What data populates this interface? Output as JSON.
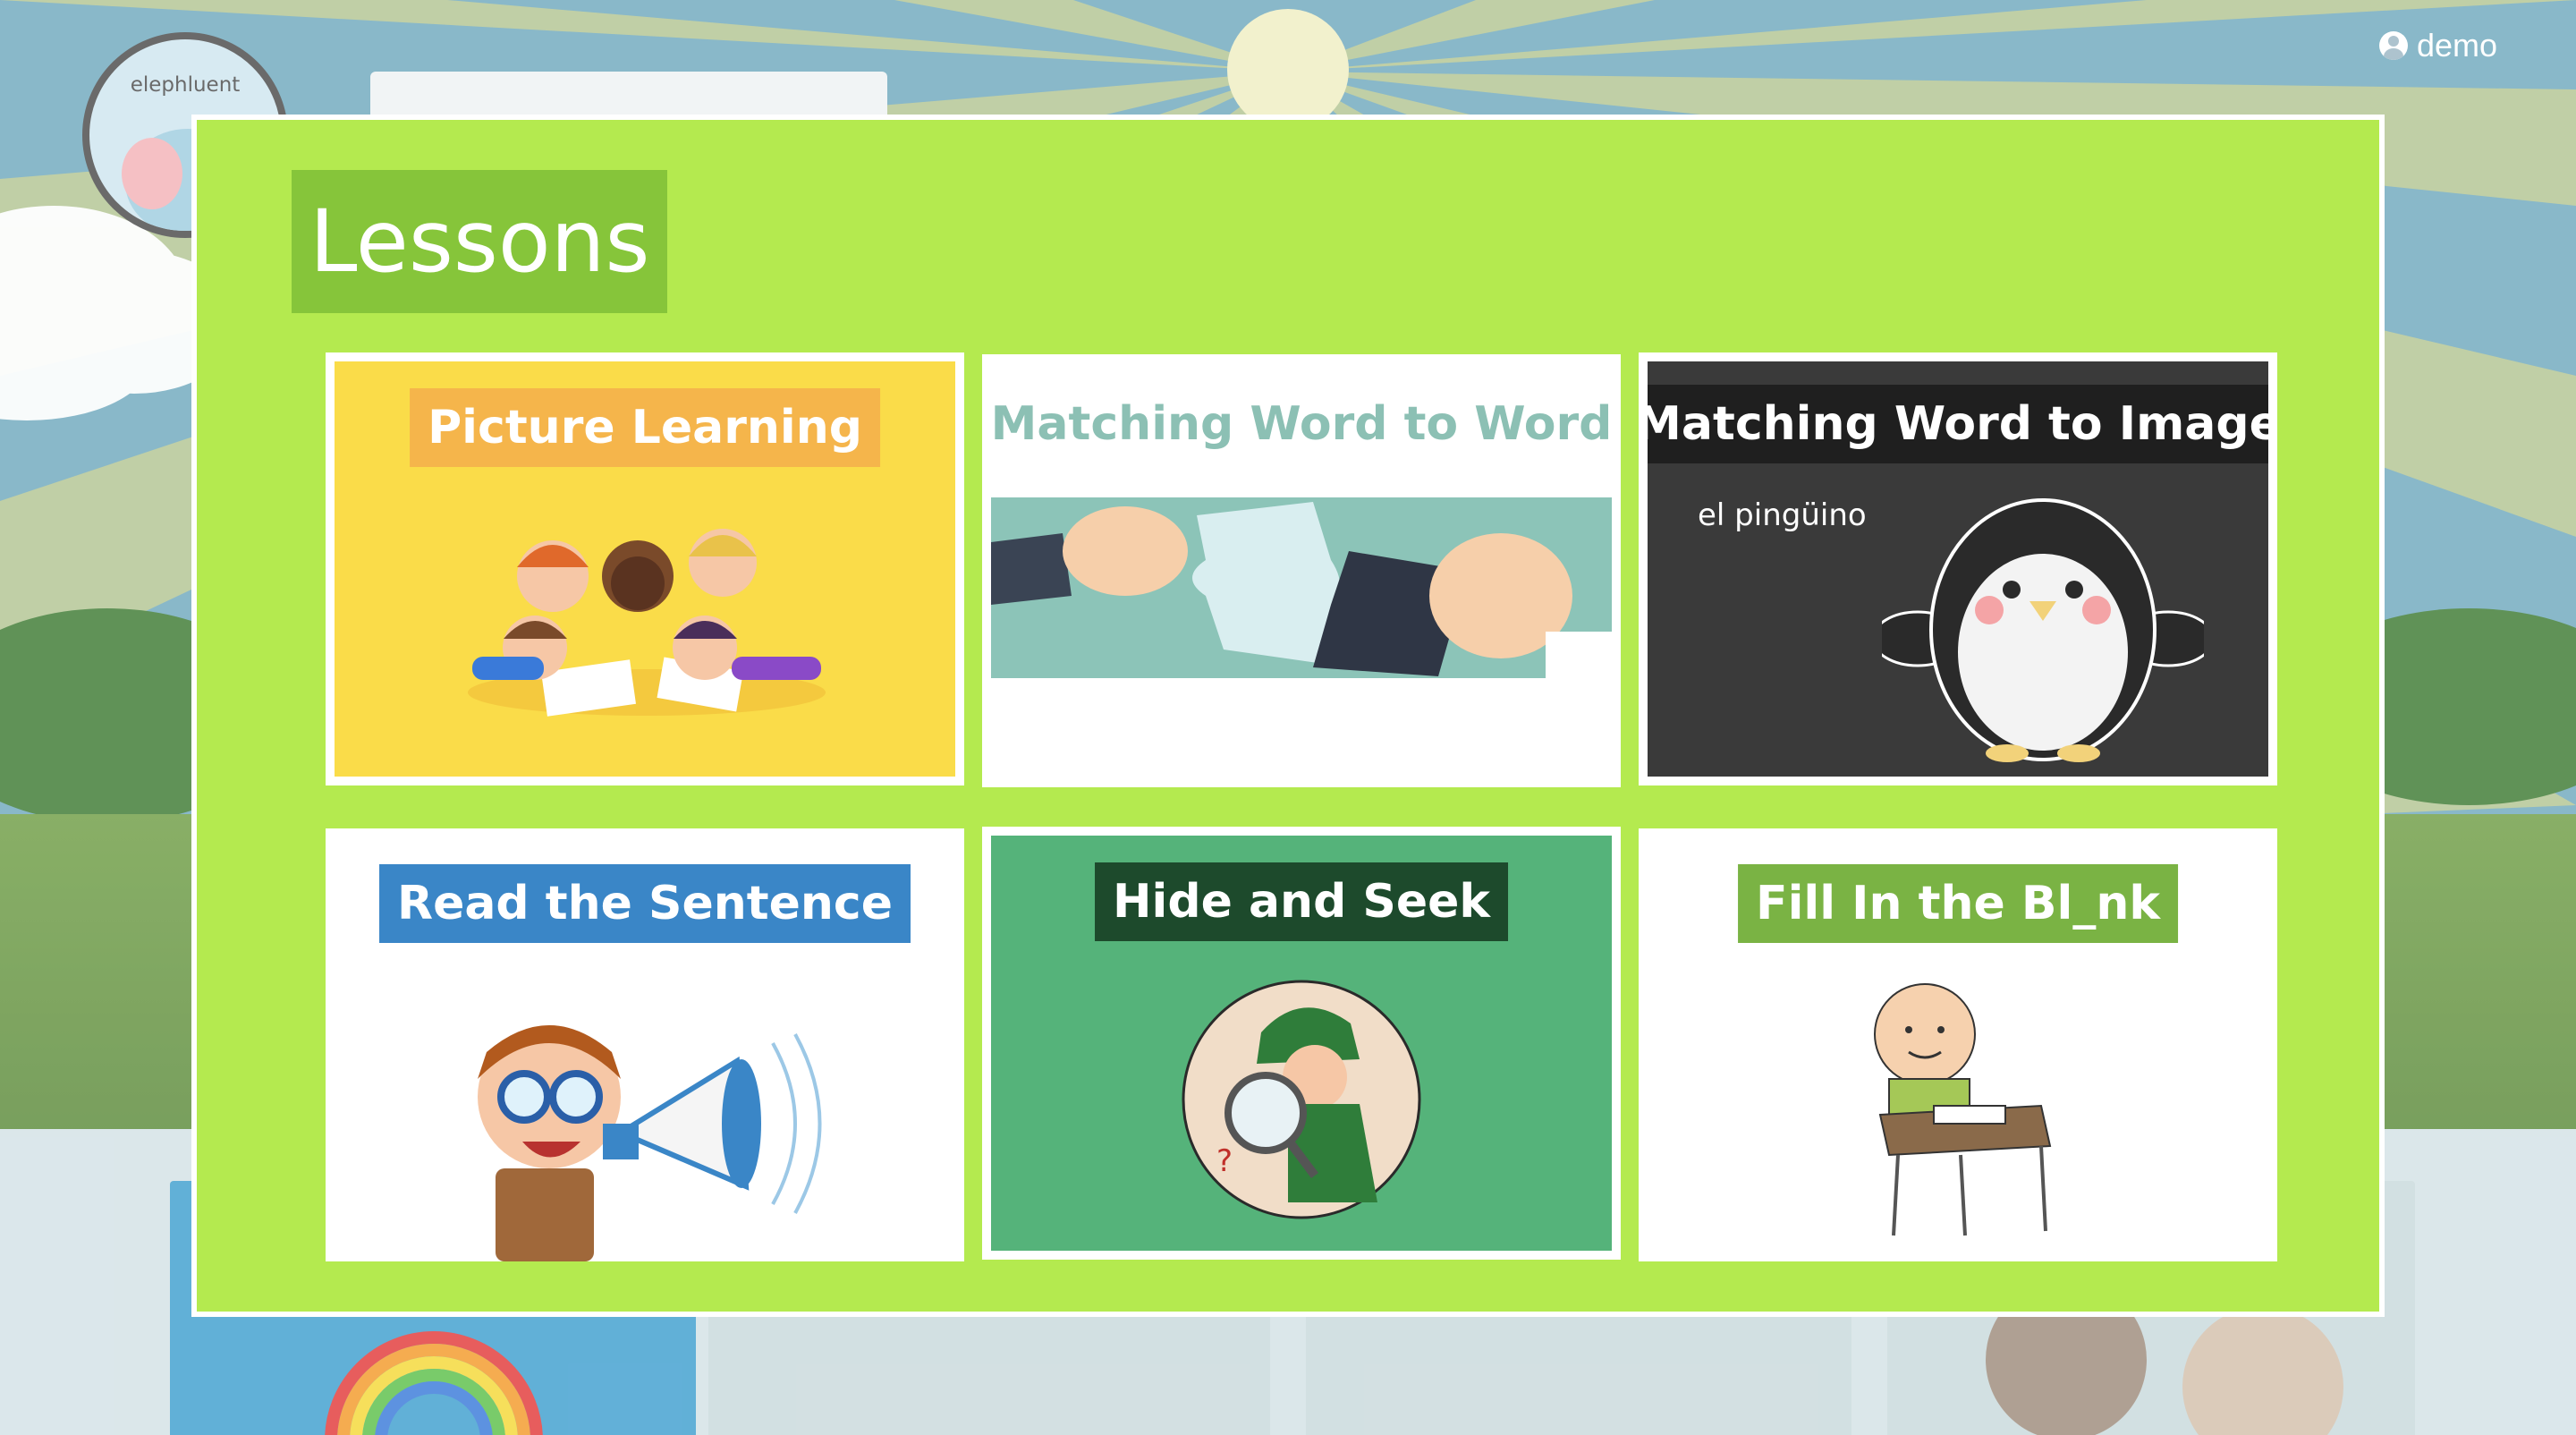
{
  "app": {
    "logo_text": "elephluent"
  },
  "user": {
    "name": "demo",
    "icon": "user-circle-icon"
  },
  "modal": {
    "title": "Lessons",
    "lessons": [
      {
        "label": "Picture Learning",
        "illustration": "children-drawing-illustration",
        "colors": {
          "card": "#fadc49",
          "label_bg": "#f5b54b",
          "label_text": "#ffffff"
        }
      },
      {
        "label": "Matching Word to Word",
        "illustration": "puzzle-pieces-illustration",
        "colors": {
          "card": "#ffffff",
          "label_bg": "#ffffff",
          "label_text": "#8cc0b4"
        }
      },
      {
        "label": "Matching Word to Image",
        "example_word": "el pingüino",
        "illustration": "penguin-illustration",
        "colors": {
          "card": "#3a3a3a",
          "label_bg": "#1f1f1f",
          "label_text": "#ffffff"
        }
      },
      {
        "label": "Read the Sentence",
        "illustration": "boy-megaphone-illustration",
        "colors": {
          "card": "#ffffff",
          "label_bg": "#3a86c7",
          "label_text": "#ffffff"
        }
      },
      {
        "label": "Hide and Seek",
        "illustration": "detective-magnifier-illustration",
        "colors": {
          "card": "#55b37a",
          "label_bg": "#1d4a2c",
          "label_text": "#ffffff"
        }
      },
      {
        "label": "Fill In the Bl_nk",
        "illustration": "boy-at-desk-illustration",
        "colors": {
          "card": "#ffffff",
          "label_bg": "#7ab344",
          "label_text": "#ffffff"
        }
      }
    ]
  },
  "colors": {
    "modal_bg": "#b4ea4f",
    "title_bg": "#86c53a",
    "accent": "#b4ea4f"
  }
}
